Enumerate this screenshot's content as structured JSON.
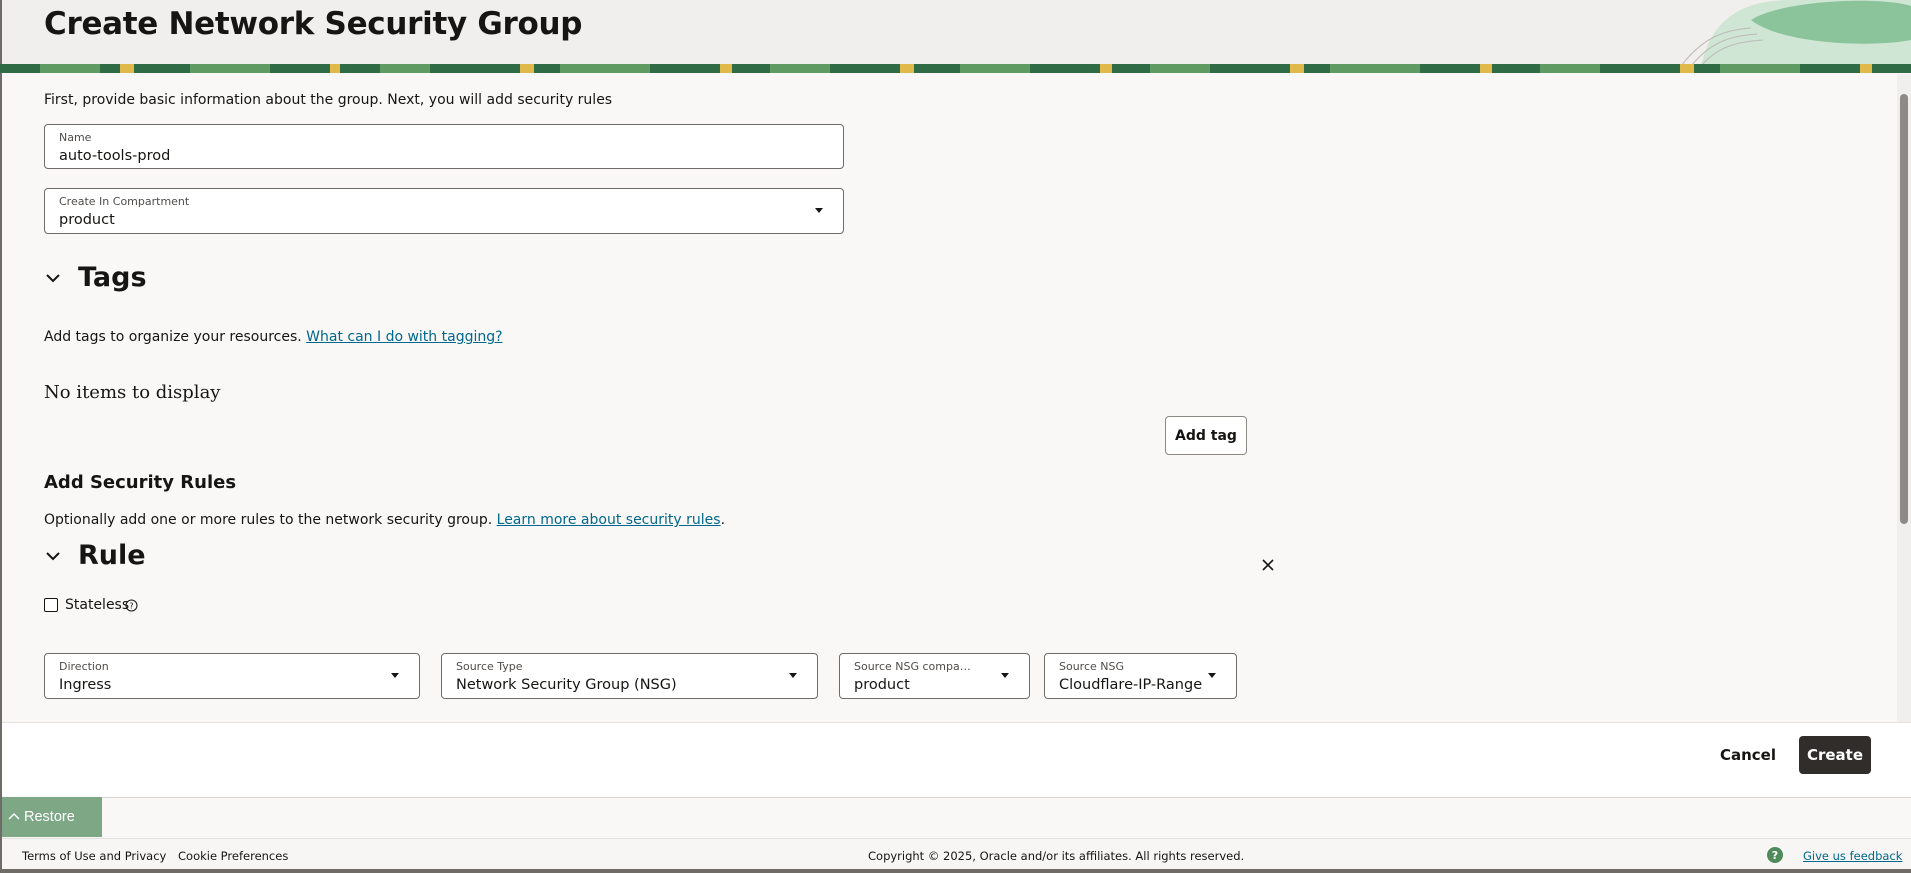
{
  "header": {
    "title": "Create Network Security Group"
  },
  "intro": "First, provide basic information about the group. Next, you will add security rules",
  "name_field": {
    "label": "Name",
    "value": "auto-tools-prod"
  },
  "compartment_field": {
    "label": "Create In Compartment",
    "value": "product"
  },
  "tags": {
    "title": "Tags",
    "description": "Add tags to organize your resources.",
    "help_link": "What can I do with tagging?",
    "empty_text": "No items to display",
    "add_button": "Add tag"
  },
  "security_rules": {
    "heading": "Add Security Rules",
    "description": "Optionally add one or more rules to the network security group.",
    "learn_link": "Learn more about security rules",
    "period": "."
  },
  "rule": {
    "title": "Rule",
    "stateless_label": "Stateless",
    "stateless_checked": false,
    "direction": {
      "label": "Direction",
      "value": "Ingress"
    },
    "source_type": {
      "label": "Source Type",
      "value": "Network Security Group (NSG)"
    },
    "source_nsg_compartment": {
      "label": "Source NSG compa…",
      "value": "product"
    },
    "source_nsg": {
      "label": "Source NSG",
      "value": "Cloudflare-IP-Range"
    }
  },
  "actions": {
    "cancel": "Cancel",
    "create": "Create"
  },
  "restore": {
    "label": "Restore"
  },
  "footer": {
    "terms": "Terms of Use and Privacy",
    "cookies": "Cookie Preferences",
    "copyright": "Copyright © 2025, Oracle and/or its affiliates. All rights reserved.",
    "feedback": "Give us feedback",
    "help_glyph": "?"
  },
  "colors": {
    "primary_button": "#312d2a",
    "link": "#00688c",
    "restore_bg": "#7ea785"
  },
  "icons": [
    "chevron-down-icon",
    "close-icon",
    "help-icon",
    "dropdown-caret-icon",
    "restore-chevron-icon",
    "feedback-help-icon"
  ]
}
